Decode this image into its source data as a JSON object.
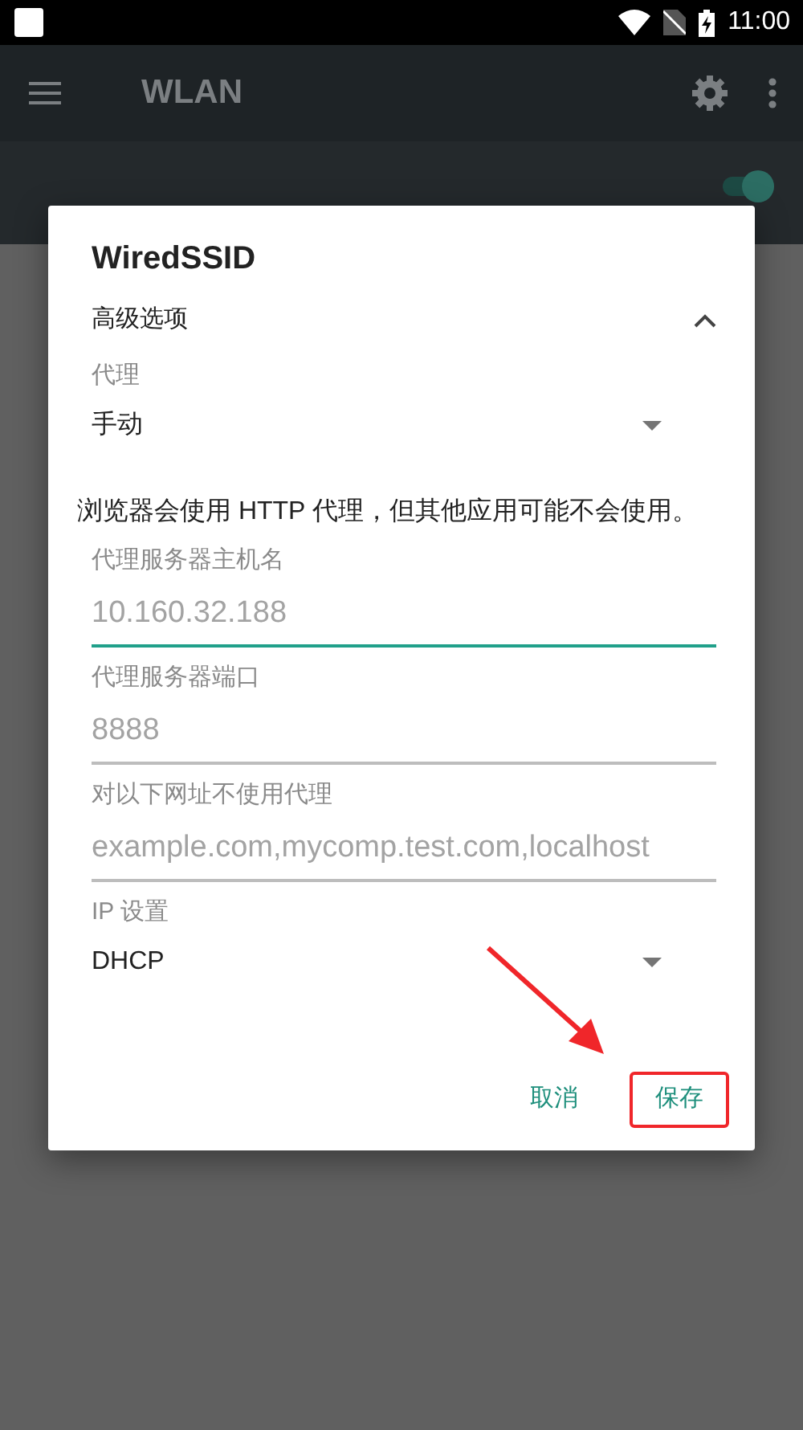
{
  "status_bar": {
    "time": "11:00"
  },
  "app_bar": {
    "title": "WLAN"
  },
  "wifi_switch": {
    "on": true
  },
  "dialog": {
    "title": "WiredSSID",
    "advanced": {
      "label": "高级选项",
      "expanded": true
    },
    "proxy": {
      "label": "代理",
      "value": "手动"
    },
    "note": "浏览器会使用 HTTP 代理，但其他应用可能不会使用。",
    "fields": [
      {
        "label": "代理服务器主机名",
        "placeholder": "10.160.32.188",
        "focused": true
      },
      {
        "label": "代理服务器端口",
        "placeholder": "8888",
        "focused": false
      },
      {
        "label": "对以下网址不使用代理",
        "placeholder": "example.com,mycomp.test.com,localhost",
        "focused": false
      }
    ],
    "ip": {
      "label": "IP 设置",
      "value": "DHCP"
    },
    "buttons": [
      {
        "label": "取消",
        "highlighted": false
      },
      {
        "label": "保存",
        "highlighted": true
      }
    ]
  }
}
